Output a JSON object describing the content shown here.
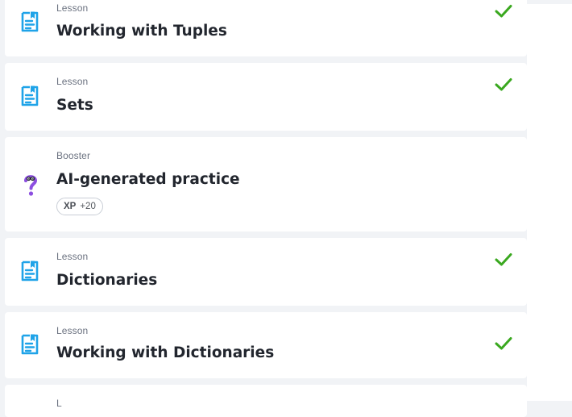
{
  "items": [
    {
      "type": "Lesson",
      "title": "Working with Tuples",
      "completed": true
    },
    {
      "type": "Lesson",
      "title": "Sets",
      "completed": true
    },
    {
      "type": "Booster",
      "title": "AI-generated practice",
      "completed": false,
      "xp_label": "XP",
      "xp_value": "+20"
    },
    {
      "type": "Lesson",
      "title": "Dictionaries",
      "completed": true
    },
    {
      "type": "Lesson",
      "title": "Working with Dictionaries",
      "completed": true
    },
    {
      "type": "L",
      "title": "",
      "completed": false
    }
  ],
  "colors": {
    "lesson_icon": "#1fa3e8",
    "booster_icon": "#8c4ee0",
    "check": "#3aa81f",
    "background": "#f1f3f6",
    "card": "#ffffff"
  },
  "icons": {
    "lesson": "document-icon",
    "booster": "question-mark-icon",
    "completed": "checkmark-icon"
  }
}
